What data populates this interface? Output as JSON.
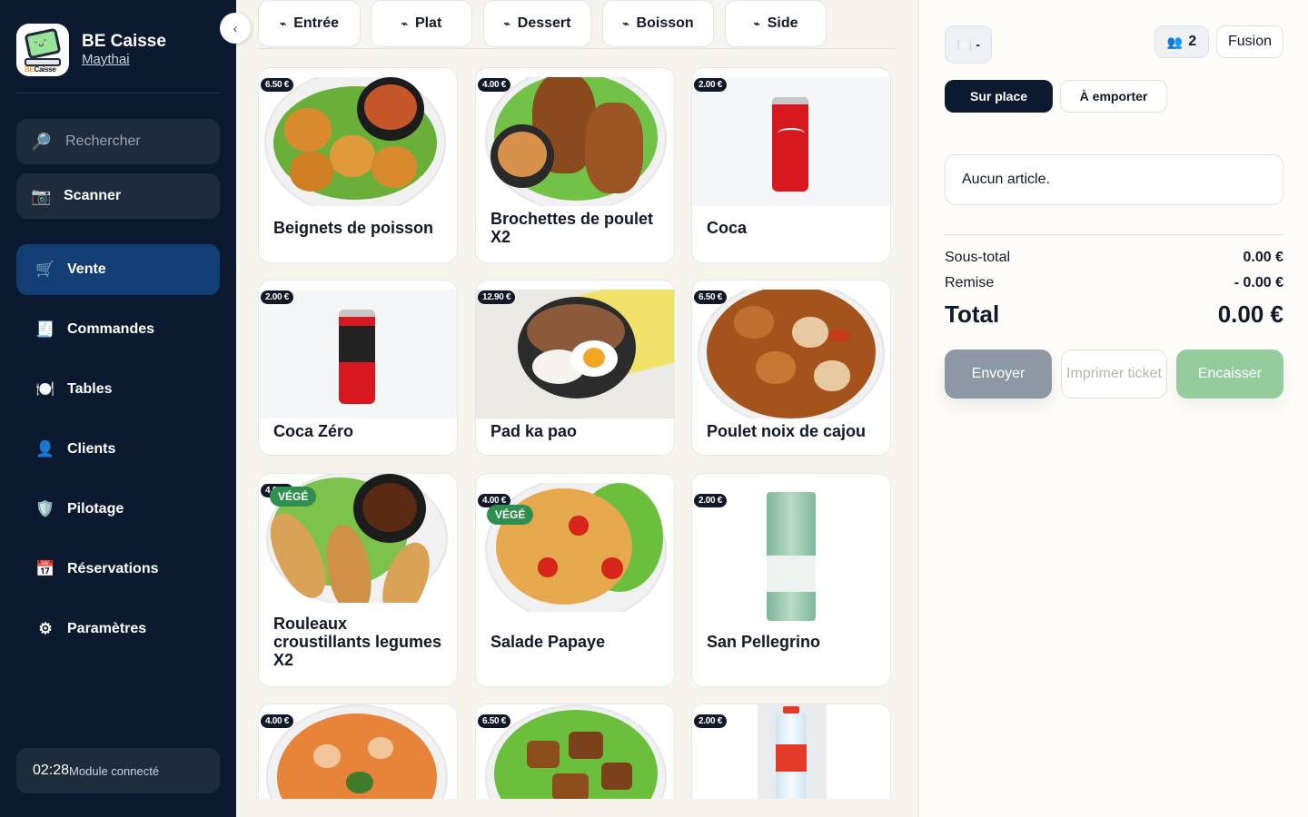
{
  "app": {
    "name": "BE Caisse",
    "restaurant": "Maythai",
    "logo_text_be": "BE",
    "logo_text_caisse": "Caisse"
  },
  "sidebar": {
    "collapse_glyph": "‹",
    "search": {
      "placeholder": "Rechercher",
      "icon": "🔎"
    },
    "scanner": {
      "label": "Scanner",
      "icon": "📷"
    },
    "items": [
      {
        "label": "Vente",
        "icon": "🛒",
        "active": true
      },
      {
        "label": "Commandes",
        "icon": "🧾"
      },
      {
        "label": "Tables",
        "icon": "🍽️"
      },
      {
        "label": "Clients",
        "icon": "👤"
      },
      {
        "label": "Pilotage",
        "icon": "🛡️"
      },
      {
        "label": "Réservations",
        "icon": "📅"
      },
      {
        "label": "Paramètres",
        "icon": "⚙"
      }
    ],
    "status": {
      "time": "02:28",
      "text": "Module connecté"
    }
  },
  "categories": [
    {
      "label": "Entrée"
    },
    {
      "label": "Plat"
    },
    {
      "label": "Dessert"
    },
    {
      "label": "Boisson"
    },
    {
      "label": "Side"
    }
  ],
  "category_icon": "⌁",
  "products": [
    {
      "name": "Beignets de poisson",
      "price": "6.50 €"
    },
    {
      "name": "Brochettes de poulet X2",
      "price": "4.00 €"
    },
    {
      "name": "Coca",
      "price": "2.00 €"
    },
    {
      "name": "Coca Zéro",
      "price": "2.00 €"
    },
    {
      "name": "Pad ka pao",
      "price": "12.90 €"
    },
    {
      "name": "Poulet noix de cajou",
      "price": "6.50 €"
    },
    {
      "name": "Rouleaux croustillants legumes X2",
      "price": "4.00 €",
      "badge": "VÉGÉ"
    },
    {
      "name": "Salade Papaye",
      "price": "4.00 €",
      "badge": "VÉGÉ"
    },
    {
      "name": "San Pellegrino",
      "price": "2.00 €"
    },
    {
      "price": "4.00 €"
    },
    {
      "price": "6.50 €"
    },
    {
      "price": "2.00 €"
    }
  ],
  "order": {
    "table_label": "-",
    "table_icon": "🍽️",
    "guests": "2",
    "guests_icon": "👥",
    "mode_tag": "Fusion",
    "modes": {
      "on_site": "Sur place",
      "takeaway": "À emporter"
    },
    "empty_text": "Aucun article.",
    "subtotal_label": "Sous-total",
    "subtotal_value": "0.00 €",
    "discount_label": "Remise",
    "discount_value": "- 0.00 €",
    "total_label": "Total",
    "total_value": "0.00 €",
    "actions": {
      "send": "Envoyer",
      "print": "Imprimer ticket",
      "cash": "Encaisser"
    }
  },
  "colors": {
    "sidebar_bg": "#0b1a2e",
    "active_nav": "#123e75",
    "cash_green": "#94cc9e",
    "veg_green": "#2f8f4e"
  }
}
